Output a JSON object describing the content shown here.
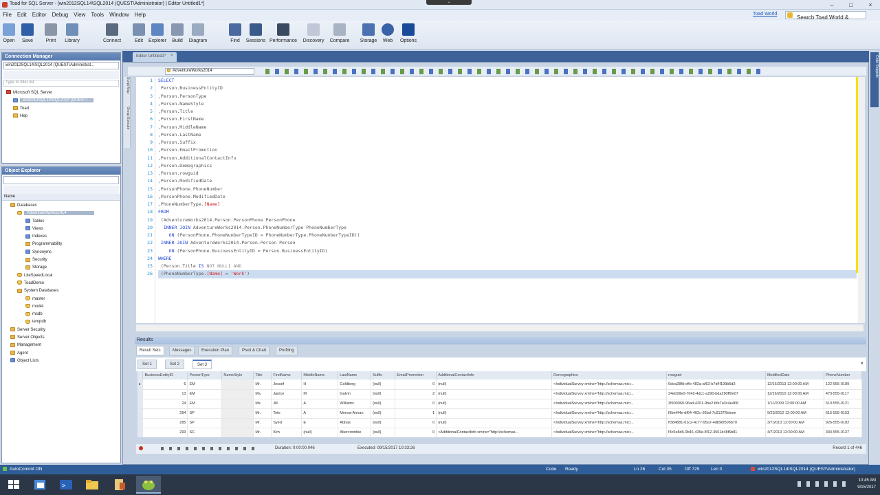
{
  "title": "Toad for SQL Server - [win2012SQL14\\SQL2014 (QUEST\\Administrator) | Editor Untitled1*]",
  "menu": [
    "File",
    "Edit",
    "Editor",
    "Debug",
    "View",
    "Tools",
    "Window",
    "Help"
  ],
  "toad_world": "Toad World",
  "search_placeholder": "Search Toad World & Support",
  "toolbar": [
    "Open",
    "Save",
    "Print",
    "Library",
    "Connect",
    "Edit",
    "Explorer",
    "Build",
    "Diagram",
    "Find",
    "Sessions",
    "Performance",
    "Discovery",
    "Compare",
    "Storage",
    "Web",
    "Options"
  ],
  "conn_manager": {
    "title": "Connection Manager",
    "combo": "win2012SQL14\\SQL2014 (QUEST\\Administrat...",
    "filter": "Type to filter list",
    "root": "Microsoft SQL Server",
    "server": "win2012SQL14\\SQL2014 (QUEST\\...",
    "items": [
      "Toad",
      "Hep"
    ]
  },
  "object_explorer": {
    "title": "Object Explorer",
    "col": "Name",
    "tree": [
      "Databases",
      "AdventureWorks2014",
      "Tables",
      "Views",
      "Indexes",
      "Programmability",
      "Synonyms",
      "Security",
      "Storage",
      "LiteSpeedLocal",
      "ToadDemo",
      "System Databases",
      "master",
      "model",
      "msdb",
      "tempdb",
      "Server Security",
      "Server Objects",
      "Management",
      "Agent",
      "Object Lists"
    ]
  },
  "editor": {
    "tab": "Editor Untitled1*",
    "db": "AdventureWorks2014",
    "side1": "Script Map",
    "side2": "Group Execute",
    "right": "Code Snippets"
  },
  "code": [
    [
      [
        "kw",
        "SELECT"
      ]
    ],
    [
      [
        "t",
        " Person.BusinessEntityID"
      ]
    ],
    [
      [
        "t",
        ",Person.PersonType"
      ]
    ],
    [
      [
        "t",
        ",Person.NameStyle"
      ]
    ],
    [
      [
        "t",
        ",Person.Title"
      ]
    ],
    [
      [
        "t",
        ",Person.FirstName"
      ]
    ],
    [
      [
        "t",
        ",Person.MiddleName"
      ]
    ],
    [
      [
        "t",
        ",Person.LastName"
      ]
    ],
    [
      [
        "t",
        ",Person.Suffix"
      ]
    ],
    [
      [
        "t",
        ",Person.EmailPromotion"
      ]
    ],
    [
      [
        "t",
        ",Person.AdditionalContactInfo"
      ]
    ],
    [
      [
        "t",
        ",Person.Demographics"
      ]
    ],
    [
      [
        "t",
        ",Person.rowguid"
      ]
    ],
    [
      [
        "t",
        ",Person.ModifiedDate"
      ]
    ],
    [
      [
        "t",
        ",PersonPhone.PhoneNumber"
      ]
    ],
    [
      [
        "t",
        ",PersonPhone.ModifiedDate"
      ]
    ],
    [
      [
        "t",
        ",PhoneNumberType."
      ],
      [
        "str",
        "[Name]"
      ]
    ],
    [
      [
        "kw",
        "FROM"
      ]
    ],
    [
      [
        "t",
        " (AdventureWorks2014.Person.PersonPhone PersonPhone"
      ]
    ],
    [
      [
        "t",
        "  "
      ],
      [
        "kw",
        "INNER JOIN"
      ],
      [
        "t",
        " AdventureWorks2014.Person.PhoneNumberType PhoneNumberType"
      ]
    ],
    [
      [
        "t",
        "    "
      ],
      [
        "kw",
        "ON"
      ],
      [
        "t",
        " (PersonPhone.PhoneNumberTypeID = PhoneNumberType.PhoneNumberTypeID))"
      ]
    ],
    [
      [
        "t",
        " "
      ],
      [
        "kw",
        "INNER JOIN"
      ],
      [
        "t",
        " AdventureWorks2014.Person.Person Person"
      ]
    ],
    [
      [
        "t",
        "    "
      ],
      [
        "kw",
        "ON"
      ],
      [
        "t",
        " (PersonPhone.BusinessEntityID = Person.BusinessEntityID)"
      ]
    ],
    [
      [
        "kw",
        "WHERE"
      ]
    ],
    [
      [
        "t",
        " (Person.Title "
      ],
      [
        "kw",
        "IS"
      ],
      [
        "t",
        " "
      ],
      [
        "kw2",
        "NOT NULL"
      ],
      [
        "t",
        ") "
      ],
      [
        "kw2",
        "AND"
      ]
    ],
    [
      [
        "t",
        " (PhoneNumberType."
      ],
      [
        "str",
        "[Name]"
      ],
      [
        "t",
        " = "
      ],
      [
        "str",
        "'Work'"
      ],
      [
        "t",
        ")"
      ]
    ]
  ],
  "results": {
    "title": "Results",
    "tabs": [
      "Result Sets",
      "Messages",
      "Execution Plan",
      "Pivot & Chart",
      "Profiling"
    ],
    "sets": [
      "Set 1",
      "Set 2",
      "Set 3"
    ],
    "columns": [
      "BusinessEntityID",
      "PersonType",
      "NameStyle",
      "Title",
      "FirstName",
      "MiddleName",
      "LastName",
      "Suffix",
      "EmailPromotion",
      "AdditionalContactInfo",
      "Demographics",
      "rowguid",
      "ModifiedDate",
      "PhoneNumber"
    ],
    "rows": [
      [
        "6",
        "EM",
        "",
        "Mr.",
        "Jossef",
        "H",
        "Goldberg",
        "(null)",
        "0",
        "(null)",
        "<IndividualSurvey xmlns=\"http://schemas.micr...",
        "0dea28fd-effe-482a-af63-b7d4f199b5d3",
        "12/16/2013 12:00:00 AM",
        "122-555-0189"
      ],
      [
        "13",
        "EM",
        "",
        "Ms.",
        "Janice",
        "M",
        "Galvin",
        "(null)",
        "2",
        "(null)",
        "<IndividualSurvey xmlns=\"http://schemas.micr...",
        "34eb99e0-7042-4dc1-a290-bda290ff0e07",
        "12/16/2010 12:00:00 AM",
        "473-555-0117"
      ],
      [
        "24",
        "EM",
        "",
        "Ms.",
        "Jill",
        "A",
        "Williams",
        "(null)",
        "0",
        "(null)",
        "<IndividualSurvey xmlns=\"http://schemas.micr...",
        "3f903060-96ad-4201-9be2-bfe7a3c4e468",
        "1/11/2009 12:00:00 AM",
        "510-555-0121"
      ],
      [
        "284",
        "SP",
        "",
        "Mr.",
        "Tete",
        "A",
        "Mensa-Annan",
        "(null)",
        "1",
        "(null)",
        "<IndividualSurvey xmlns=\"http://schemas.micr...",
        "f8be4f4e-df64-402c-93bd-7c9137f9deee",
        "9/23/2012 12:00:00 AM",
        "615-555-0153"
      ],
      [
        "285",
        "SP",
        "",
        "Mr.",
        "Syed",
        "E",
        "Abbas",
        "(null)",
        "0",
        "(null)",
        "<IndividualSurvey xmlns=\"http://schemas.micr...",
        "ff384881-01c2-4c77-95a7-4db96f506b70",
        "3/7/2013 12:00:00 AM",
        "926-555-0182"
      ],
      [
        "293",
        "SC",
        "",
        "Mr.",
        "Kim",
        "(null)",
        "Abercrombie",
        "(null)",
        "0",
        "<AdditionalContactInfo xmlns=\"http://schemas...",
        "<IndividualSurvey xmlns=\"http://schemas.micr...",
        "f3c5e8d6-0b46-439e-8f12-3561d48f6b81",
        "4/7/2013 12:00:00 AM",
        "334-555-0137"
      ]
    ],
    "duration": "Duration: 0:00:00.046",
    "executed": "Executed: 09/15/2017 10:33:26",
    "record": "Record 1 of 446"
  },
  "status": {
    "autocommit": "AutoCommit ON",
    "code": "Code",
    "ready": "Ready",
    "ln": "Ln 26",
    "col": "Col 35",
    "off": "Off 729",
    "len": "Len 0",
    "conn": "win2012SQL14\\SQL2014 (QUEST\\Administrator)"
  },
  "clock": {
    "time": "10:45 AM",
    "date": "9/15/2017"
  }
}
